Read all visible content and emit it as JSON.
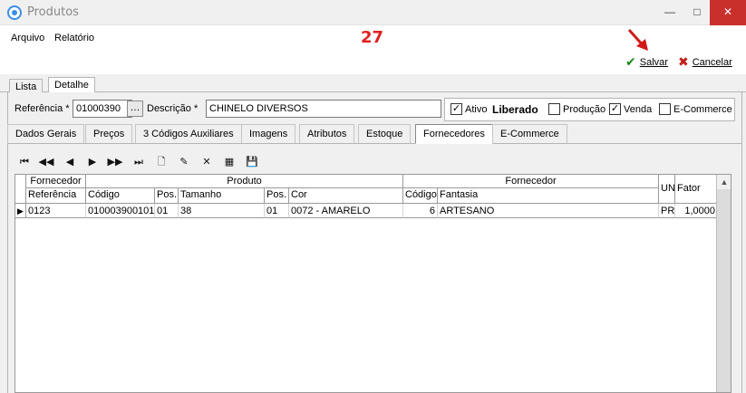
{
  "window": {
    "title": "Produtos"
  },
  "menu": {
    "arquivo": "Arquivo",
    "relatorio": "Relatório"
  },
  "annotation": {
    "badge": "27"
  },
  "actions": {
    "salvar": "Salvar",
    "cancelar": "Cancelar"
  },
  "outer_tabs": {
    "lista": "Lista",
    "detalhe": "Detalhe",
    "active": "Detalhe"
  },
  "fields": {
    "referencia_label": "Referência *",
    "referencia_value": "01000390",
    "descricao_label": "Descrição *",
    "descricao_value": "CHINELO DIVERSOS",
    "ativo_label": "Ativo",
    "ativo_checked": true,
    "liberado_label": "Liberado",
    "producao_label": "Produção",
    "producao_checked": false,
    "venda_label": "Venda",
    "venda_checked": true,
    "ecommerce_label": "E-Commerce",
    "ecommerce_checked": false
  },
  "sub_tabs": {
    "dados_gerais": "Dados Gerais",
    "precos": "Preços",
    "codigos_aux": "3 Códigos Auxiliares",
    "imagens": "Imagens",
    "atributos": "Atributos",
    "estoque": "Estoque",
    "fornecedores": "Fornecedores",
    "ecommerce": "E-Commerce",
    "active": "Fornecedores"
  },
  "toolbar": {
    "icons": [
      "first-icon",
      "prior-page-icon",
      "prior-icon",
      "next-icon",
      "next-page-icon",
      "last-icon",
      "new-icon",
      "edit-icon",
      "delete-icon",
      "properties-icon",
      "save-icon"
    ]
  },
  "grid": {
    "group_headers": {
      "fornecedor": "Fornecedor",
      "produto": "Produto",
      "fornecedor2": "Fornecedor"
    },
    "columns": {
      "referencia": "Referência",
      "codigo": "Código",
      "pos1": "Pos.",
      "tamanho": "Tamanho",
      "pos2": "Pos.",
      "cor": "Cor",
      "codigo2": "Código",
      "fantasia": "Fantasia",
      "un": "UN",
      "fator": "Fator"
    },
    "rows": [
      {
        "referencia": "0123",
        "codigo": "010003900101",
        "pos1": "01",
        "tamanho": "38",
        "pos2": "01",
        "cor": "0072 - AMARELO",
        "codigo2": "6",
        "fantasia": "ARTESANO",
        "un": "PR",
        "fator": "1,0000"
      }
    ]
  }
}
